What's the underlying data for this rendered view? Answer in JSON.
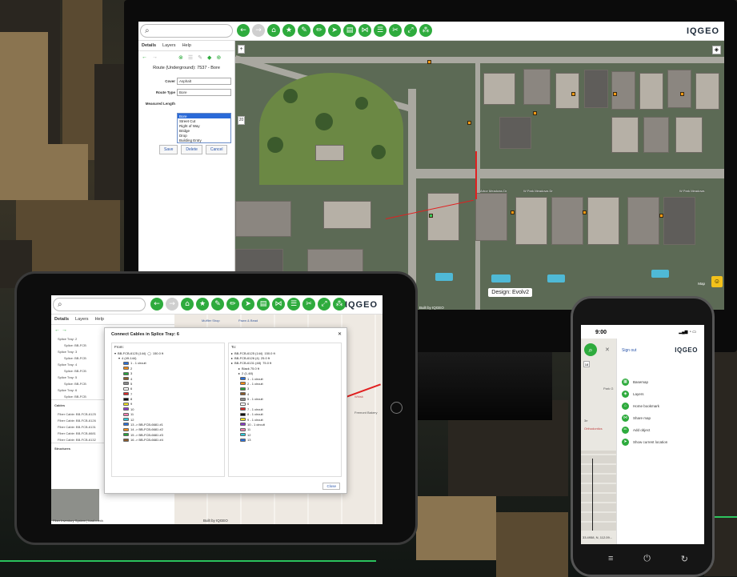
{
  "monitor": {
    "logo": "IQGEO",
    "search_icon": "search-icon",
    "tools": [
      "arrow-left-icon",
      "arrow-right-icon",
      "home-icon",
      "star-icon",
      "ruler-icon",
      "pencil-icon",
      "navigate-icon",
      "print-icon",
      "share-icon",
      "list-icon",
      "scissors-icon",
      "expand-icon",
      "network-icon"
    ],
    "tabs": [
      "Details",
      "Layers",
      "Help"
    ],
    "panel_title": "Route (Underground): 7537 - Bore",
    "fields": [
      {
        "label": "Cover",
        "value": "Asphalt"
      },
      {
        "label": "Route Type",
        "value": "Bore"
      },
      {
        "label": "Measured Length",
        "value": ""
      }
    ],
    "dropdown_options": [
      "Bore",
      "Street Cut",
      "Right of Way",
      "Bridge",
      "Drop",
      "Building Entry"
    ],
    "dropdown_selected": "Bore",
    "buttons": {
      "save": "Save",
      "delete": "Delete",
      "cancel": "Cancel"
    },
    "street_labels": [
      "Arbor Meadows Dr",
      "W Park Meadows Dr",
      "W Park Meadows"
    ],
    "design_label": "Design: Evolv2",
    "built_by": "Built by IQGEO",
    "map_brand": "Map"
  },
  "tablet": {
    "logo": "IQGEO",
    "tabs": [
      "Details",
      "Layers",
      "Help"
    ],
    "dialog_title": "Connect Cables in Splice Tray: 6",
    "from_label": "From:",
    "to_label": "To:",
    "from_header": "BB-FCB-6125 (144)",
    "from_length": "150.0 ft",
    "from_sub": "4 (49-144)",
    "to_rows": [
      {
        "label": "BB-FCB-6125 (144)",
        "len": "150.0 ft"
      },
      {
        "label": "BB-FCB-6126 (4)",
        "len": "25.0 ft"
      },
      {
        "label": "BB-FCB-6131 (48)",
        "len": "75.0 ft"
      },
      {
        "label": "Black 75.0 ft",
        "len": ""
      },
      {
        "label": "2 (1-48)",
        "len": ""
      }
    ],
    "from_fibers": [
      {
        "n": "1",
        "txt": "1 - 1 circuit",
        "c": "#2b6fd6"
      },
      {
        "n": "2",
        "txt": "2",
        "c": "#f08a16"
      },
      {
        "n": "3",
        "txt": "3",
        "c": "#27a33d"
      },
      {
        "n": "4",
        "txt": "4",
        "c": "#8a5a2a"
      },
      {
        "n": "5",
        "txt": "5",
        "c": "#8a8a8a"
      },
      {
        "n": "6",
        "txt": "6",
        "c": "#ffffff"
      },
      {
        "n": "7",
        "txt": "7",
        "c": "#d62b2b"
      },
      {
        "n": "8",
        "txt": "8",
        "c": "#111111"
      },
      {
        "n": "9",
        "txt": "9",
        "c": "#f0e020"
      },
      {
        "n": "10",
        "txt": "10",
        "c": "#8a3ac8"
      },
      {
        "n": "11",
        "txt": "11",
        "c": "#f080b0"
      },
      {
        "n": "12",
        "txt": "12",
        "c": "#30c8d8"
      },
      {
        "n": "13",
        "txt": "13 -> BB-FCB-6681 #1",
        "c": "#2b6fd6"
      },
      {
        "n": "14",
        "txt": "14 -> BB-FCB-6681 #2",
        "c": "#f08a16"
      },
      {
        "n": "15",
        "txt": "15 -> BB-FCB-6681 #3",
        "c": "#27a33d"
      },
      {
        "n": "16",
        "txt": "16 -> BB-FCB-6681 #4",
        "c": "#8a5a2a"
      }
    ],
    "to_fibers": [
      {
        "n": "1",
        "txt": "1 - 1 circuit",
        "c": "#2b6fd6"
      },
      {
        "n": "2",
        "txt": "2 - 1 circuit",
        "c": "#f08a16"
      },
      {
        "n": "3",
        "txt": "3",
        "c": "#27a33d"
      },
      {
        "n": "4",
        "txt": "4",
        "c": "#8a5a2a"
      },
      {
        "n": "5",
        "txt": "5 - 1 circuit",
        "c": "#8a8a8a"
      },
      {
        "n": "6",
        "txt": "6",
        "c": "#ffffff"
      },
      {
        "n": "7",
        "txt": "7 - 1 circuit",
        "c": "#d62b2b"
      },
      {
        "n": "8",
        "txt": "8 - 1 circuit",
        "c": "#111111"
      },
      {
        "n": "9",
        "txt": "9 - 1 circuit",
        "c": "#f0e020"
      },
      {
        "n": "10",
        "txt": "10 - 1 circuit",
        "c": "#8a3ac8"
      },
      {
        "n": "11",
        "txt": "11",
        "c": "#f080b0"
      },
      {
        "n": "12",
        "txt": "12",
        "c": "#30c8d8"
      },
      {
        "n": "13",
        "txt": "13",
        "c": "#2b6fd6"
      }
    ],
    "list_rows": [
      "Splice Tray: 2",
      "Splice: BB-FCB",
      "Splice Tray: 3",
      "Splice: BB-FCB",
      "Splice Tray: 4",
      "Splice: BB-FCB",
      "Splice Tray: 5",
      "Splice: BB-FCB",
      "Splice Tray: 6",
      "Splice: BB-FCB"
    ],
    "cables_title": "Cables",
    "cable_rows": [
      "Fiber Cable: BB-FCB-6125",
      "Fiber Cable: BB-FCB-6126",
      "Fiber Cable: BB-FCB-6131",
      "Fiber Cable: BB-FCB-6681",
      "Fiber Cable: BB-FCB-6132"
    ],
    "structures_title": "Structures",
    "close_label": "Close",
    "status": "Fiber Inventory System | load.x.mth",
    "built_by": "Built by IQGEO",
    "map_labels": [
      "Muffler Shop",
      "Pawn & Bead",
      "Whisk",
      "Fremont Bakery"
    ]
  },
  "phone": {
    "time": "9:00",
    "signout": "Sign out",
    "logo": "IQGEO",
    "menu": [
      {
        "label": "Basemap",
        "icon": "map-icon"
      },
      {
        "label": "Layers",
        "icon": "layers-icon"
      },
      {
        "label": "Home bookmark",
        "icon": "home-icon"
      },
      {
        "label": "Share map",
        "icon": "share-icon"
      },
      {
        "label": "Add object",
        "icon": "pencil-icon"
      },
      {
        "label": "Show current location",
        "icon": "navigate-icon"
      }
    ],
    "map_labels": [
      "Park G",
      "Orthodontics",
      "3e",
      "Sylvan"
    ],
    "coords": "33.4958, N, 112.09..."
  }
}
